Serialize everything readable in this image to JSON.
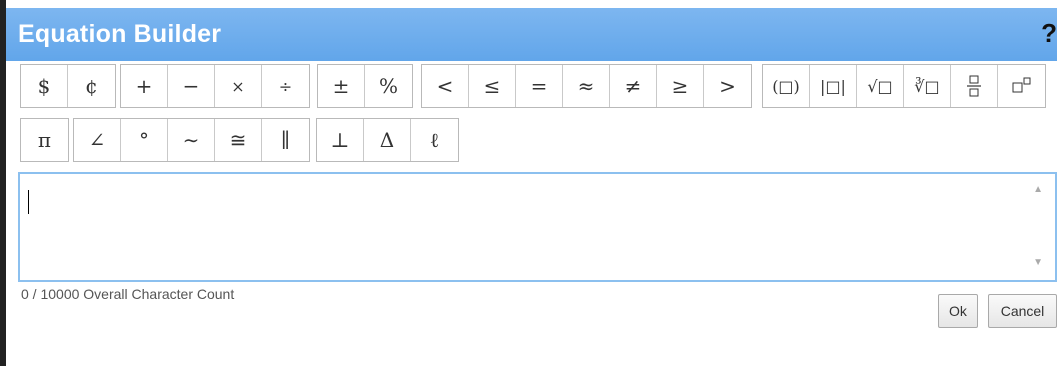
{
  "dialog": {
    "title": "Equation Builder",
    "help_label": "?"
  },
  "toolbar_row1": {
    "currency": [
      "$",
      "¢"
    ],
    "operators": [
      "+",
      "−",
      "×",
      "÷"
    ],
    "misc": [
      "±",
      "%"
    ],
    "relations": [
      "<",
      "≤",
      "=",
      "≈",
      "≠",
      "≥",
      ">"
    ],
    "templates": [
      "(□)",
      "|□|",
      "√□",
      "∛□",
      "fraction",
      "□ᵒ"
    ]
  },
  "toolbar_row2": {
    "geometry": [
      "π",
      "∠",
      "°",
      "∼",
      "≅",
      "∥",
      "⊥",
      "Δ",
      "ℓ"
    ]
  },
  "editor": {
    "value": "",
    "char_count": "0 / 10000 Overall Character Count"
  },
  "actions": {
    "ok_label": "Ok",
    "cancel_label": "Cancel"
  }
}
